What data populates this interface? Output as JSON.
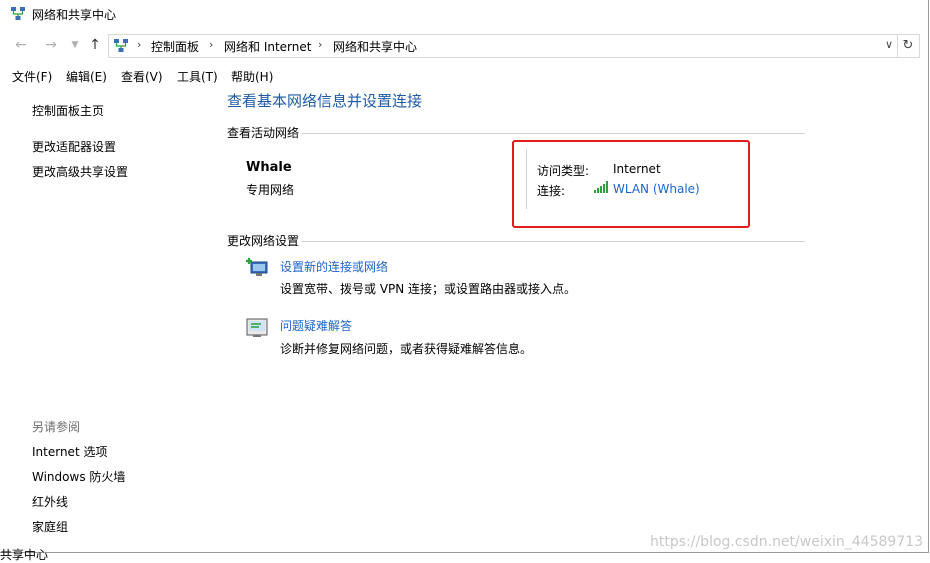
{
  "window": {
    "title": "网络和共享中心"
  },
  "address_bar": {
    "crumbs": [
      "控制面板",
      "网络和 Internet",
      "网络和共享中心"
    ]
  },
  "menu": {
    "items": [
      "文件(F)",
      "编辑(E)",
      "查看(V)",
      "工具(T)",
      "帮助(H)"
    ]
  },
  "sidebar": {
    "home": "控制面板主页",
    "links": [
      "更改适配器设置",
      "更改高级共享设置"
    ],
    "see_also_heading": "另请参阅",
    "see_also": [
      "Internet 选项",
      "Windows 防火墙",
      "红外线",
      "家庭组"
    ]
  },
  "main": {
    "title": "查看基本网络信息并设置连接",
    "active_section": "查看活动网络",
    "network_name": "Whale",
    "network_type": "专用网络",
    "access_type_label": "访问类型:",
    "access_type_value": "Internet",
    "connection_label": "连接:",
    "connection_value": "WLAN (Whale)",
    "change_section": "更改网络设置",
    "actions": [
      {
        "title": "设置新的连接或网络",
        "desc": "设置宽带、拨号或 VPN 连接；或设置路由器或接入点。",
        "icon": "new-connection-icon"
      },
      {
        "title": "问题疑难解答",
        "desc": "诊断并修复网络问题，或者获得疑难解答信息。",
        "icon": "troubleshoot-icon"
      }
    ]
  },
  "watermark": "https://blog.csdn.net/weixin_44589713",
  "taskbar_fragment": "共享中心",
  "colors": {
    "link": "#1e64c8",
    "title": "#1e5aa8",
    "highlight_box": "#e01c1c"
  }
}
